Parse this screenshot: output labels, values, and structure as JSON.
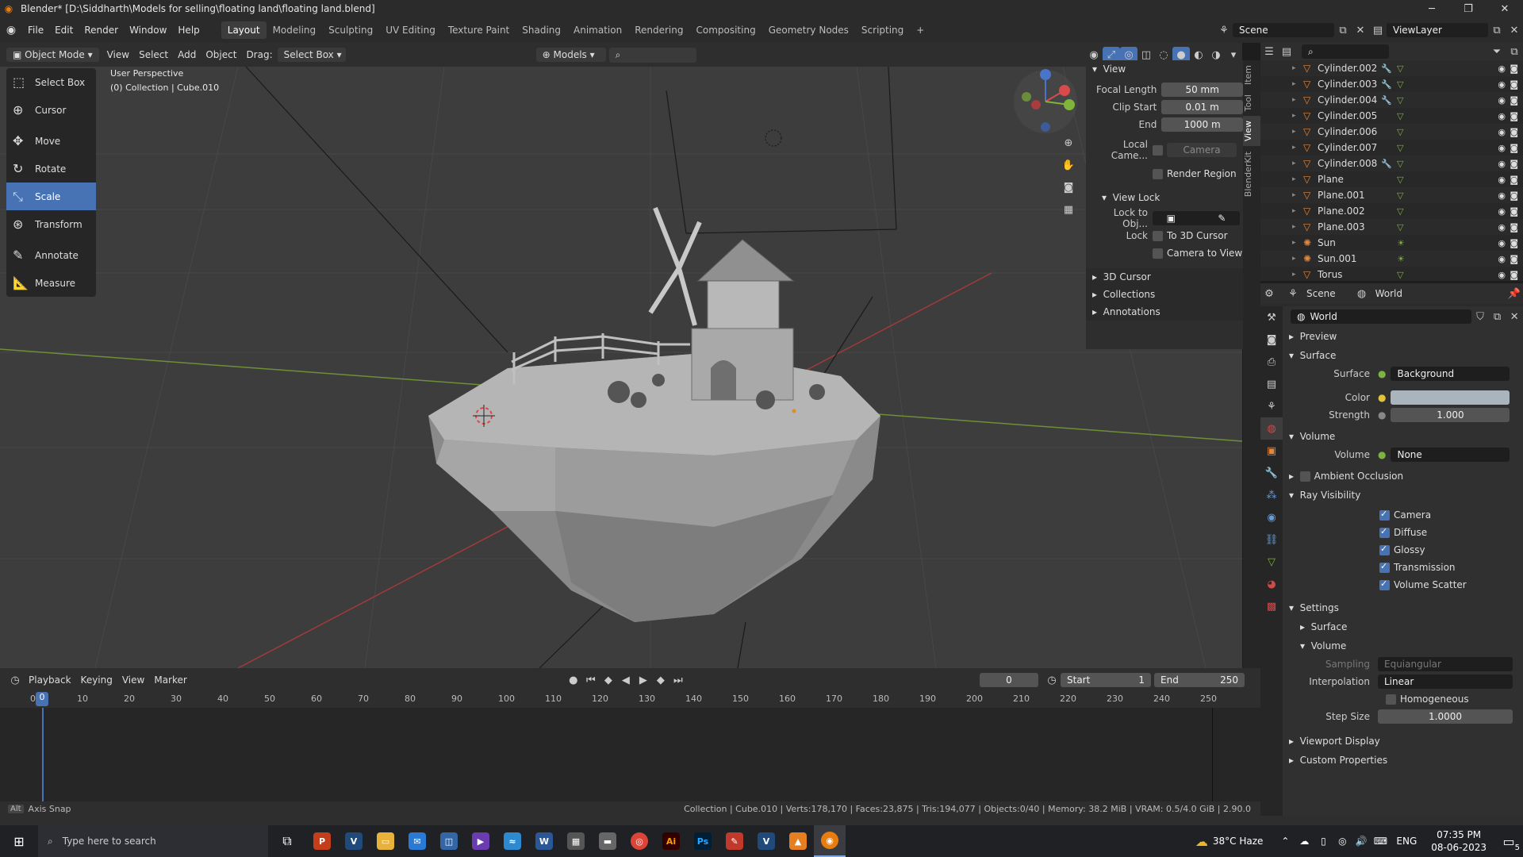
{
  "window": {
    "title": "Blender* [D:\\Siddharth\\Models for selling\\floating land\\floating land.blend]"
  },
  "menus": [
    "File",
    "Edit",
    "Render",
    "Window",
    "Help"
  ],
  "workspaces": [
    "Layout",
    "Modeling",
    "Sculpting",
    "UV Editing",
    "Texture Paint",
    "Shading",
    "Animation",
    "Rendering",
    "Compositing",
    "Geometry Nodes",
    "Scripting"
  ],
  "active_workspace": "Layout",
  "scene_name": "Scene",
  "viewlayer_name": "ViewLayer",
  "header": {
    "mode": "Object Mode",
    "view": "View",
    "select": "Select",
    "add": "Add",
    "object": "Object",
    "drag_label": "Drag:",
    "drag_value": "Select Box",
    "transform_space": "Models"
  },
  "viewport": {
    "line1": "User Perspective",
    "line2": "(0) Collection | Cube.010"
  },
  "tools": [
    "Select Box",
    "Cursor",
    "Move",
    "Rotate",
    "Scale",
    "Transform",
    "Annotate",
    "Measure"
  ],
  "active_tool": "Scale",
  "npanel": {
    "section": "View",
    "focal_length_label": "Focal Length",
    "focal_length": "50 mm",
    "clip_start_label": "Clip Start",
    "clip_start": "0.01 m",
    "end_label": "End",
    "end": "1000 m",
    "local_camera_label": "Local Came...",
    "local_camera_value": "Camera",
    "render_region": "Render Region",
    "view_lock": "View Lock",
    "lock_to_obj_label": "Lock to Obj...",
    "lock_label": "Lock",
    "to_3d_cursor": "To 3D Cursor",
    "camera_to_view": "Camera to View",
    "cursor_3d": "3D Cursor",
    "collections": "Collections",
    "annotations": "Annotations"
  },
  "sidebar_tabs": [
    "Item",
    "Tool",
    "View",
    "BlenderKit"
  ],
  "outliner_items": [
    {
      "name": "Cylinder.002",
      "mod": true
    },
    {
      "name": "Cylinder.003",
      "mod": true
    },
    {
      "name": "Cylinder.004",
      "mod": true
    },
    {
      "name": "Cylinder.005",
      "mod": false
    },
    {
      "name": "Cylinder.006",
      "mod": false
    },
    {
      "name": "Cylinder.007",
      "mod": false
    },
    {
      "name": "Cylinder.008",
      "mod": true
    },
    {
      "name": "Plane",
      "mod": false
    },
    {
      "name": "Plane.001",
      "mod": false
    },
    {
      "name": "Plane.002",
      "mod": false
    },
    {
      "name": "Plane.003",
      "mod": false
    },
    {
      "name": "Sun",
      "mod": false
    },
    {
      "name": "Sun.001",
      "mod": false
    },
    {
      "name": "Torus",
      "mod": false
    }
  ],
  "properties": {
    "crumb_scene": "Scene",
    "crumb_world": "World",
    "world_name": "World",
    "preview": "Preview",
    "surface_section": "Surface",
    "surface_label": "Surface",
    "surface_value": "Background",
    "color_label": "Color",
    "strength_label": "Strength",
    "strength": "1.000",
    "volume_section": "Volume",
    "volume_label": "Volume",
    "volume_value": "None",
    "ambient_occlusion": "Ambient Occlusion",
    "ray_visibility": "Ray Visibility",
    "ray": [
      "Camera",
      "Diffuse",
      "Glossy",
      "Transmission",
      "Volume Scatter"
    ],
    "settings": "Settings",
    "set_surface": "Surface",
    "set_volume": "Volume",
    "sampling_label": "Sampling",
    "sampling_value": "Equiangular",
    "interpolation_label": "Interpolation",
    "interpolation_value": "Linear",
    "homogeneous": "Homogeneous",
    "step_size_label": "Step Size",
    "step_size": "1.0000",
    "viewport_display": "Viewport Display",
    "custom_properties": "Custom Properties",
    "world_color": "#a9b4bc"
  },
  "timeline": {
    "playback": "Playback",
    "keying": "Keying",
    "view": "View",
    "marker": "Marker",
    "current_frame": "0",
    "start_label": "Start",
    "start": "1",
    "end_label": "End",
    "end": "250",
    "ticks": [
      "0",
      "10",
      "20",
      "30",
      "40",
      "50",
      "60",
      "70",
      "80",
      "90",
      "100",
      "110",
      "120",
      "130",
      "140",
      "150",
      "160",
      "170",
      "180",
      "190",
      "200",
      "210",
      "220",
      "230",
      "240",
      "250"
    ]
  },
  "status": {
    "left": "Axis Snap",
    "right": "Collection | Cube.010 | Verts:178,170 | Faces:23,875 | Tris:194,077 | Objects:0/40 | Memory: 38.2 MiB | VRAM: 0.5/4.0 GiB | 2.90.0"
  },
  "taskbar": {
    "search_placeholder": "Type here to search",
    "weather": "38°C  Haze",
    "lang": "ENG",
    "time": "07:35 PM",
    "date": "08-06-2023",
    "notif": "5"
  }
}
